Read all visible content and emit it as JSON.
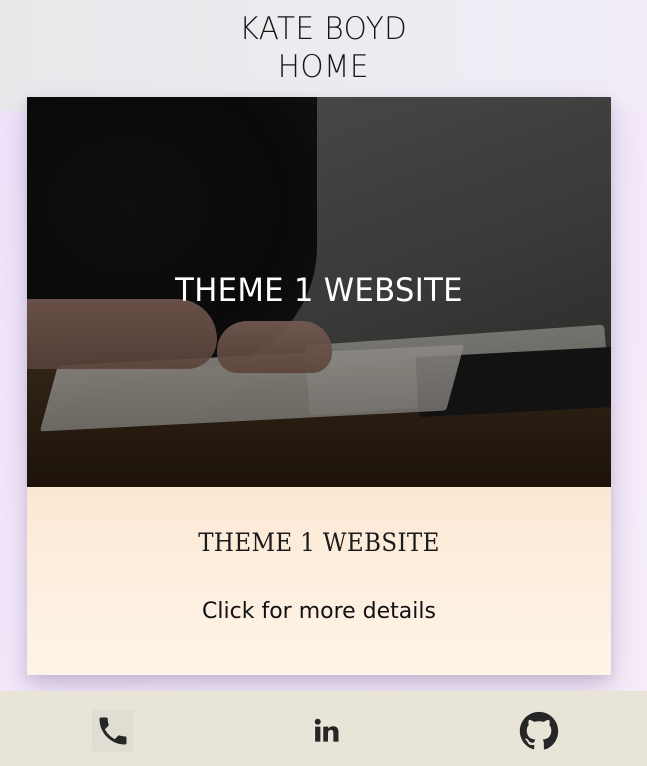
{
  "header": {
    "logo_line1": "KATE BOYD",
    "logo_line2": "HOME"
  },
  "card": {
    "overlay_title": "THEME 1 WEBSITE",
    "title": "THEME 1 WEBSITE",
    "cta": "Click for more details"
  },
  "footer": {
    "icons": [
      "phone-icon",
      "linkedin-icon",
      "github-icon"
    ]
  },
  "colors": {
    "footer_bg": "#e8e4d8",
    "card_body_bg": "#fdf0e1",
    "page_bg": "#f0e4fb",
    "icon": "#262626"
  }
}
